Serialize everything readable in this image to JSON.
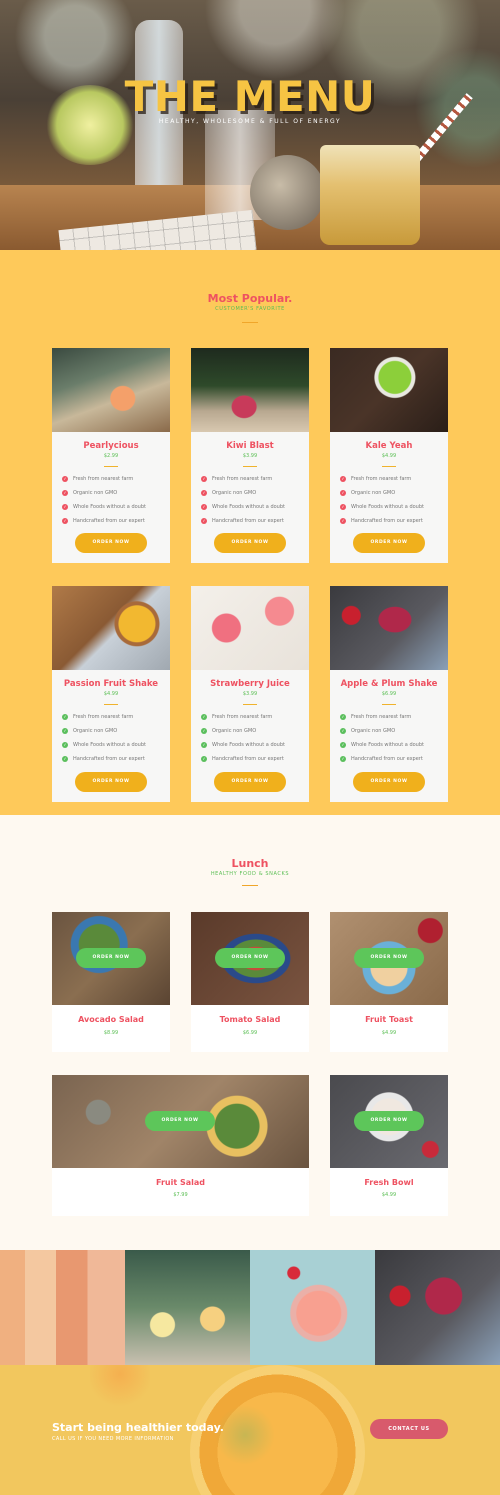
{
  "hero": {
    "title": "THE MENU",
    "subtitle": "HEALTHY, WHOLESOME & FULL OF ENERGY"
  },
  "popular": {
    "title": "Most Popular.",
    "subtitle": "CUSTOMER'S FAVORITE",
    "cards": [
      {
        "name": "Pearlycious",
        "price": "$2.99",
        "features": [
          "Fresh from nearest farm",
          "Organic non GMO",
          "Whole Foods without a doubt",
          "Handcrafted from our expert"
        ],
        "button": "ORDER NOW"
      },
      {
        "name": "Kiwi Blast",
        "price": "$3.99",
        "features": [
          "Fresh from nearest farm",
          "Organic non GMO",
          "Whole Foods without a doubt",
          "Handcrafted from our expert"
        ],
        "button": "ORDER NOW"
      },
      {
        "name": "Kale Yeah",
        "price": "$4.99",
        "features": [
          "Fresh from nearest farm",
          "Organic non GMO",
          "Whole Foods without a doubt",
          "Handcrafted from our expert"
        ],
        "button": "ORDER NOW"
      },
      {
        "name": "Passion Fruit Shake",
        "price": "$4.99",
        "features": [
          "Fresh from nearest farm",
          "Organic non GMO",
          "Whole Foods without a doubt",
          "Handcrafted from our expert"
        ],
        "button": "ORDER NOW"
      },
      {
        "name": "Strawberry Juice",
        "price": "$3.99",
        "features": [
          "Fresh from nearest farm",
          "Organic non GMO",
          "Whole Foods without a doubt",
          "Handcrafted from our expert"
        ],
        "button": "ORDER NOW"
      },
      {
        "name": "Apple & Plum Shake",
        "price": "$6.99",
        "features": [
          "Fresh from nearest farm",
          "Organic non GMO",
          "Whole Foods without a doubt",
          "Handcrafted from our expert"
        ],
        "button": "ORDER NOW"
      }
    ]
  },
  "lunch": {
    "title": "Lunch",
    "subtitle": "HEALTHY FOOD & SNACKS",
    "items": [
      {
        "name": "Avocado Salad",
        "price": "$8.99",
        "button": "ORDER NOW"
      },
      {
        "name": "Tomato Salad",
        "price": "$6.99",
        "button": "ORDER NOW"
      },
      {
        "name": "Fruit Toast",
        "price": "$4.99",
        "button": "ORDER NOW"
      },
      {
        "name": "Fruit Salad",
        "price": "$7.99",
        "button": "ORDER NOW"
      },
      {
        "name": "Fresh Bowl",
        "price": "$4.99",
        "button": "ORDER NOW"
      }
    ]
  },
  "cta": {
    "title": "Start being healthier today.",
    "subtitle": "CALL US IF YOU NEED MORE INFORMATION",
    "button": "CONTACT US"
  },
  "colors": {
    "accent_yellow": "#fec95a",
    "title_yellow": "#f6c443",
    "brand_red": "#ee5261",
    "brand_green": "#5cbf55",
    "button_gold": "#f0b01c",
    "contact_pink": "#d85a6c"
  },
  "icons": {
    "check": "check-circle-icon"
  }
}
